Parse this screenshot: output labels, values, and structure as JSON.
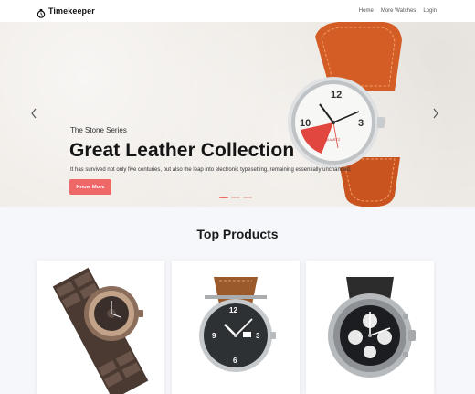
{
  "nav": {
    "brand": "Timekeeper",
    "links": [
      "Home",
      "More Watches",
      "Login"
    ]
  },
  "hero": {
    "subtitle": "The Stone Series",
    "title": "Great Leather Collection",
    "description": "It has survived not only five centuries, but also the leap into electronic typesetting, remaining essentially unchanged.",
    "button_label": "Know More",
    "slide_count": 3,
    "active_slide": 1,
    "accent": "#ef6868"
  },
  "products": {
    "heading": "Top Products"
  }
}
